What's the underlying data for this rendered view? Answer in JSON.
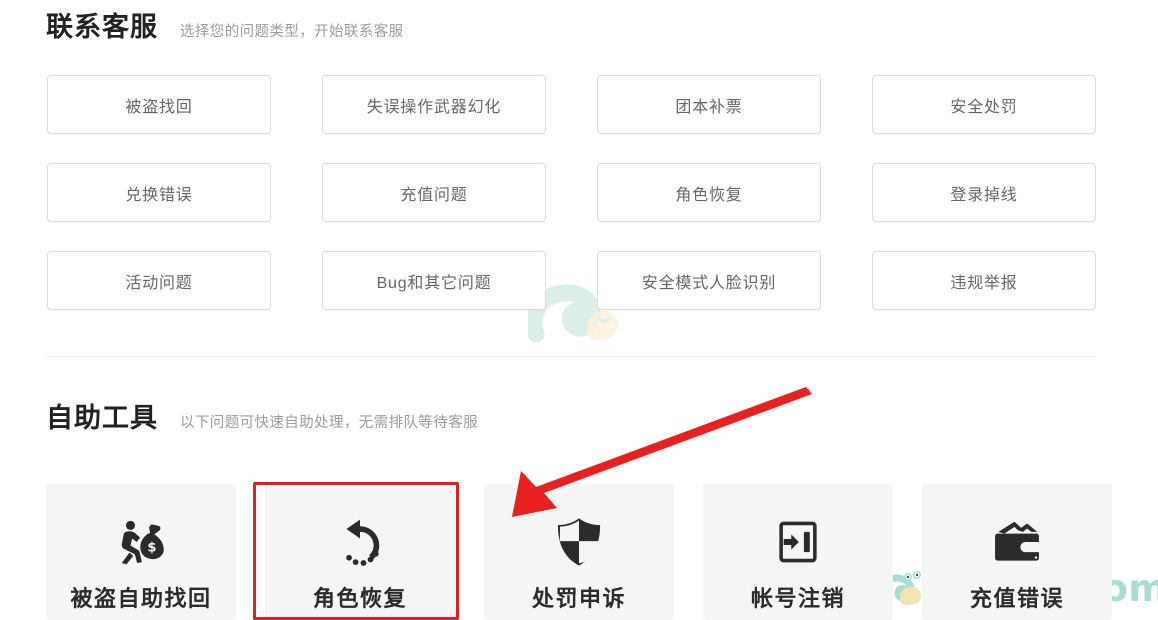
{
  "contact_section": {
    "title": "联系客服",
    "subtitle": "选择您的问题类型，开始联系客服",
    "categories": [
      {
        "label": "被盗找回"
      },
      {
        "label": "失误操作武器幻化"
      },
      {
        "label": "团本补票"
      },
      {
        "label": "安全处罚"
      },
      {
        "label": "兑换错误"
      },
      {
        "label": "充值问题"
      },
      {
        "label": "角色恢复"
      },
      {
        "label": "登录掉线"
      },
      {
        "label": "活动问题"
      },
      {
        "label": "Bug和其它问题"
      },
      {
        "label": "安全模式人脸识别"
      },
      {
        "label": "违规举报"
      }
    ]
  },
  "tools_section": {
    "title": "自助工具",
    "subtitle": "以下问题可快速自助处理，无需排队等待客服",
    "tools": [
      {
        "label": "被盗自助找回",
        "icon": "thief-money-bag-icon"
      },
      {
        "label": "角色恢复",
        "icon": "restore-undo-arrow-icon"
      },
      {
        "label": "处罚申诉",
        "icon": "shield-icon"
      },
      {
        "label": "帐号注销",
        "icon": "logout-arrow-icon"
      },
      {
        "label": "充值错误",
        "icon": "wallet-icon"
      }
    ]
  },
  "annotations": {
    "highlight_target": "角色恢复",
    "arrow_color": "#e8201f",
    "box_color": "#e02020"
  },
  "watermark": {
    "brand_text": "yxwoo.com",
    "brand_color": "#a8ddd2",
    "snail_icon": "snail-logo-icon"
  }
}
